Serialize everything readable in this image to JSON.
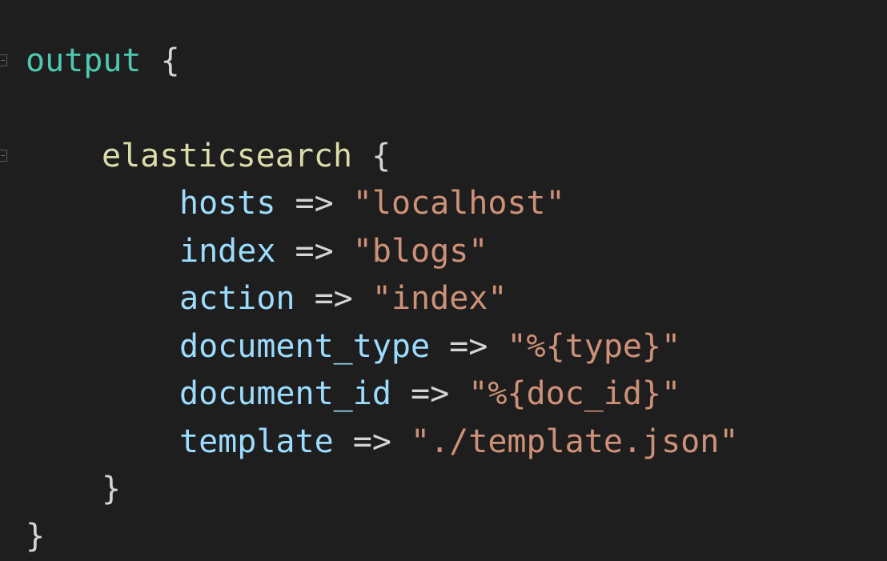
{
  "code": {
    "output_keyword": "output",
    "output_open": "{",
    "plugin_name": "elasticsearch",
    "plugin_open": "{",
    "settings": [
      {
        "key": "hosts",
        "arrow": "=>",
        "value": "\"localhost\""
      },
      {
        "key": "index",
        "arrow": "=>",
        "value": "\"blogs\""
      },
      {
        "key": "action",
        "arrow": "=>",
        "value": "\"index\""
      },
      {
        "key": "document_type",
        "arrow": "=>",
        "value": "\"%{type}\""
      },
      {
        "key": "document_id",
        "arrow": "=>",
        "value": "\"%{doc_id}\""
      },
      {
        "key": "template",
        "arrow": "=>",
        "value": "\"./template.json\""
      }
    ],
    "plugin_close": "}",
    "output_close": "}"
  },
  "colors": {
    "background": "#1e1e1e",
    "keyword_output": "#4ec9b0",
    "plugin_name": "#dcdcaa",
    "setting_key": "#9cdcfe",
    "string_value": "#ce9178",
    "punctuation": "#d4d4d4"
  },
  "icons": {
    "fold_output": "fold-collapse-icon",
    "fold_plugin": "fold-collapse-icon"
  }
}
